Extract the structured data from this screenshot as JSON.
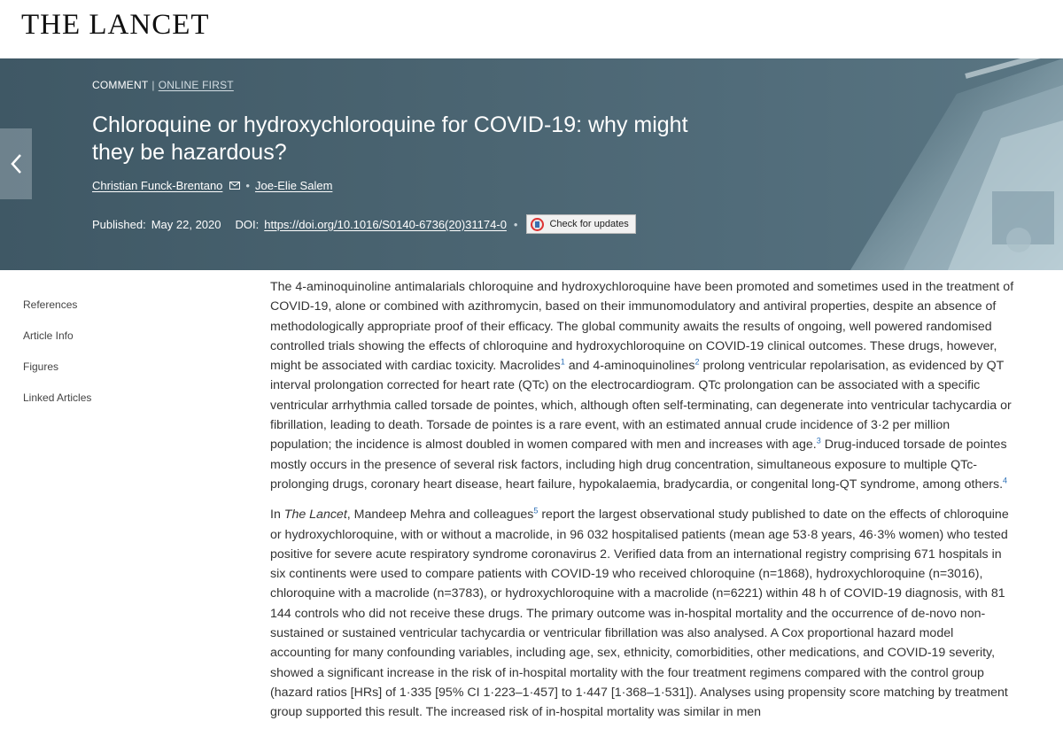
{
  "site": {
    "logo": "THE LANCET"
  },
  "article": {
    "category": "COMMENT",
    "status": "ONLINE FIRST",
    "title": "Chloroquine or hydroxychloroquine for COVID-19: why might they be hazardous?",
    "authors": [
      "Christian Funck-Brentano",
      "Joe-Elie Salem"
    ],
    "published_label": "Published:",
    "published_date": "May 22, 2020",
    "doi_label": "DOI:",
    "doi": "https://doi.org/10.1016/S0140-6736(20)31174-0",
    "check_updates": "Check for updates"
  },
  "sidenav": {
    "items": [
      "References",
      "Article Info",
      "Figures",
      "Linked Articles"
    ]
  },
  "icons": {
    "back": "chevron-left-icon",
    "mail": "envelope-icon",
    "updates": "crossmark-icon"
  },
  "colors": {
    "hero": "#4b6572",
    "link": "#2b6fb7"
  },
  "content": {
    "p1": {
      "a": "The 4-aminoquinoline antimalarials chloroquine and hydroxychloroquine have been promoted and sometimes used in the treatment of COVID-19, alone or combined with azithromycin, based on their immunomodulatory and antiviral properties, despite an absence of methodologically appropriate proof of their efficacy. The global community awaits the results of ongoing, well powered randomised controlled trials showing the effects of chloroquine and hydroxychloroquine on COVID-19 clinical outcomes. These drugs, however, might be associated with cardiac toxicity. Macrolides",
      "ref1": "1",
      "b": " and 4-aminoquinolines",
      "ref2": "2",
      "c": " prolong ventricular repolarisation, as evidenced by QT interval prolongation corrected for heart rate (QTc) on the electrocardiogram. QTc prolongation can be associated with a specific ventricular arrhythmia called torsade de pointes, which, although often self-terminating, can degenerate into ventricular tachycardia or fibrillation, leading to death. Torsade de pointes is a rare event, with an estimated annual crude incidence of 3·2 per million population; the incidence is almost doubled in women compared with men and increases with age.",
      "ref3": "3",
      "d": " Drug-induced torsade de pointes mostly occurs in the presence of several risk factors, including high drug concentration, simultaneous exposure to multiple QTc-prolonging drugs, coronary heart disease, heart failure, hypokalaemia, bradycardia, or congenital long-QT syndrome, among others.",
      "ref4": "4"
    },
    "p2": {
      "a": "In ",
      "journal": "The Lancet",
      "b": ", Mandeep Mehra and colleagues",
      "ref5": "5",
      "c": " report the largest observational study published to date on the effects of chloroquine or hydroxychloroquine, with or without a macrolide, in 96 032 hospitalised patients (mean age 53·8 years, 46·3% women) who tested positive for severe acute respiratory syndrome coronavirus 2. Verified data from an international registry comprising 671 hospitals in six continents were used to compare patients with COVID-19 who received chloroquine (n=1868), hydroxychloroquine (n=3016), chloroquine with a macrolide (n=3783), or hydroxychloroquine with a macrolide (n=6221) within 48 h of COVID-19 diagnosis, with 81 144 controls who did not receive these drugs. The primary outcome was in-hospital mortality and the occurrence of de-novo non-sustained or sustained ventricular tachycardia or ventricular fibrillation was also analysed. A Cox proportional hazard model accounting for many confounding variables, including age, sex, ethnicity, comorbidities, other medications, and COVID-19 severity, showed a significant increase in the risk of in-hospital mortality with the four treatment regimens compared with the control group (hazard ratios [HRs] of 1·335 [95% CI 1·223–1·457] to 1·447 [1·368–1·531]). Analyses using propensity score matching by treatment group supported this result. The increased risk of in-hospital mortality was similar in men"
    }
  }
}
